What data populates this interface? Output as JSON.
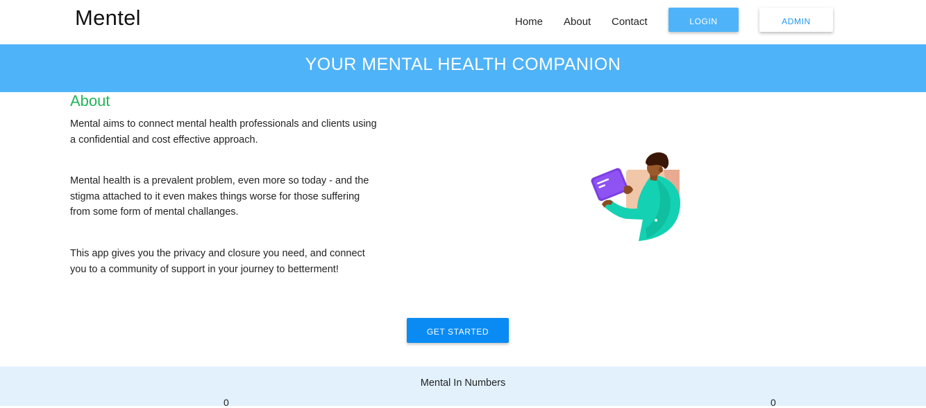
{
  "brand": "Mentel",
  "nav": {
    "links": [
      "Home",
      "About",
      "Contact"
    ],
    "login_label": "LOGIN",
    "admin_label": "ADMIN"
  },
  "hero": {
    "title": "YOUR MENTAL HEALTH COMPANION"
  },
  "about": {
    "heading": "About",
    "paragraphs": [
      "Mental aims to connect mental health professionals and clients using a confidential and cost effective approach.",
      "Mental health is a prevalent problem, even more so today - and the stigma attached to it even makes things worse for those suffering from some form of mental challanges.",
      "This app gives you the privacy and closure you need, and connect you to a community of support in your journey to betterment!"
    ]
  },
  "cta": {
    "label": "GET STARTED"
  },
  "numbers": {
    "title": "Mental In Numbers",
    "counts": [
      "0",
      "0"
    ]
  },
  "colors": {
    "accent_blue": "#4fb3f9",
    "button_blue": "#0a8bf3",
    "heading_green": "#22b55a",
    "numbers_bg": "#e2f1fc"
  },
  "icons": {
    "illustration": "person-holding-tablet-illustration"
  }
}
